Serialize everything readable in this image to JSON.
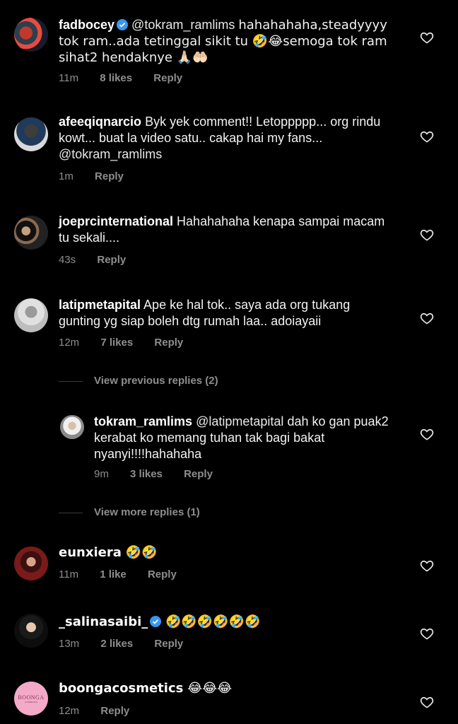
{
  "comments": [
    {
      "username": "fadbocey",
      "verified": true,
      "text_mention": "@tokram_ramlims",
      "text": "hahahahaha,steadyyyy tok ram..ada tetinggal sikit tu 🤣😂semoga tok ram sihat2 hendaknye 🙏🏻🤲🏻",
      "time": "11m",
      "likes": "8 likes",
      "reply": "Reply"
    },
    {
      "username": "afeeqiqnarcio",
      "text": "Byk yek comment!! Letoppppp... org rindu kowt... buat la video satu.. cakap hai my fans...",
      "text_mention": "@tokram_ramlims",
      "time": "1m",
      "reply": "Reply"
    },
    {
      "username": "joeprcinternational",
      "text": "Hahahahaha kenapa sampai macam tu sekali....",
      "time": "43s",
      "reply": "Reply"
    },
    {
      "username": "latipmetapital",
      "text": "Ape ke hal tok.. saya ada org tukang gunting yg siap boleh dtg rumah laa.. adoiayaii",
      "time": "12m",
      "likes": "7 likes",
      "reply": "Reply"
    },
    {
      "username": "eunxiera",
      "text": "🤣🤣",
      "time": "11m",
      "likes": "1 like",
      "reply": "Reply"
    },
    {
      "username": "_salinasaibi_",
      "verified": true,
      "text": "🤣🤣🤣🤣🤣🤣",
      "time": "13m",
      "likes": "2 likes",
      "reply": "Reply"
    },
    {
      "username": "boongacosmetics",
      "text": "😂😂😂",
      "time": "12m",
      "reply": "Reply",
      "avatar_logo": "BOONGA",
      "avatar_logo_sub": "COSMETICS"
    }
  ],
  "view_previous": "View previous replies (2)",
  "view_more": "View more replies (1)",
  "reply": {
    "username": "tokram_ramlims",
    "text_mention": "@latipmetapital",
    "text": "dah ko gan puak2 kerabat ko memang tuhan tak bagi bakat nyanyi!!!!hahahaha",
    "time": "9m",
    "likes": "3 likes",
    "reply": "Reply"
  },
  "colors": {
    "background": "#000000",
    "meta": "#8e8e8e",
    "verified": "#3897f0",
    "boonga_pink": "#f4a9c8"
  },
  "icons": [
    "heart-icon",
    "verified-badge-icon"
  ]
}
